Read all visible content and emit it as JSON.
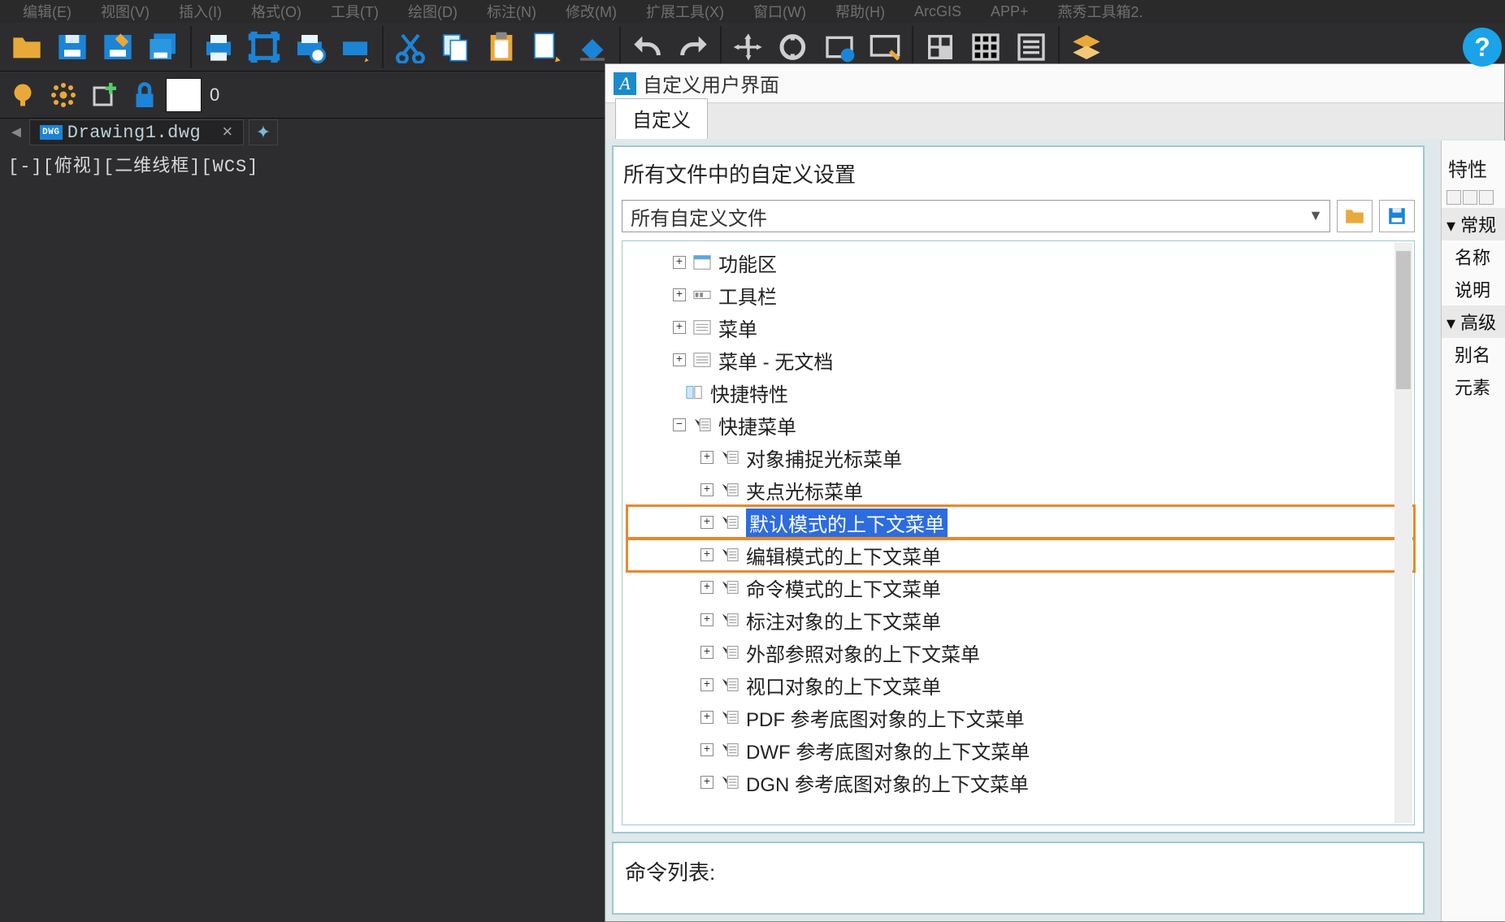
{
  "menubar": [
    "编辑(E)",
    "视图(V)",
    "插入(I)",
    "格式(O)",
    "工具(T)",
    "绘图(D)",
    "标注(N)",
    "修改(M)",
    "扩展工具(X)",
    "窗口(W)",
    "帮助(H)",
    "ArcGIS",
    "APP+",
    "燕秀工具箱2."
  ],
  "doc_tab": {
    "name": "Drawing1.dwg",
    "icon_text": "DWG"
  },
  "coord_line": "[-][俯视][二维线框][WCS]",
  "zero": "0",
  "dialog": {
    "title": "自定义用户界面",
    "tab": "自定义",
    "section1_title": "所有文件中的自定义设置",
    "dropdown": "所有自定义文件",
    "cmd_list_title": "命令列表:",
    "tree": {
      "n0": "功能区",
      "n1": "工具栏",
      "n2": "菜单",
      "n3": "菜单 - 无文档",
      "n4": "快捷特性",
      "n5": "快捷菜单",
      "c0": "对象捕捉光标菜单",
      "c1": "夹点光标菜单",
      "c2": "默认模式的上下文菜单",
      "c3": "编辑模式的上下文菜单",
      "c4": "命令模式的上下文菜单",
      "c5": "标注对象的上下文菜单",
      "c6": "外部参照对象的上下文菜单",
      "c7": "视口对象的上下文菜单",
      "c8": "PDF 参考底图对象的上下文菜单",
      "c9": "DWF 参考底图对象的上下文菜单",
      "c10": "DGN 参考底图对象的上下文菜单"
    }
  },
  "right_panel": {
    "title": "特性",
    "group1": "常规",
    "g1r1": "名称",
    "g1r2": "说明",
    "group2": "高级",
    "g2r1": "别名",
    "g2r2": "元素"
  }
}
